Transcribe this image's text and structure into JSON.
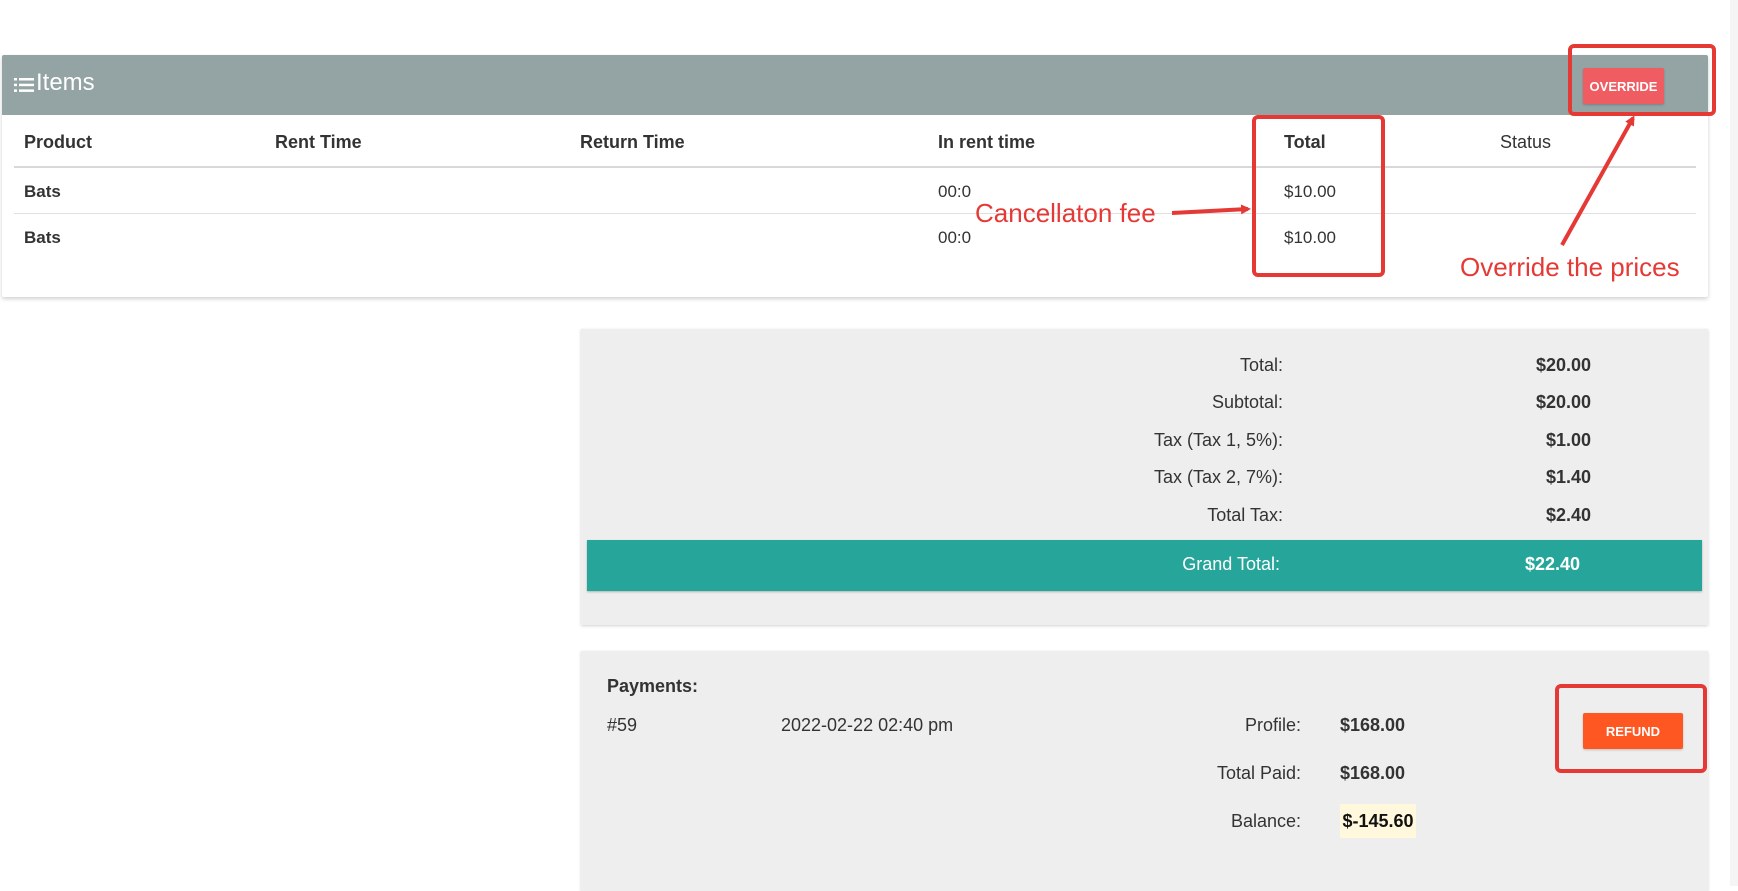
{
  "items": {
    "title": "Items",
    "override_label": "OVERRIDE",
    "columns": [
      "Product",
      "Rent Time",
      "Return Time",
      "In rent time",
      "Total",
      "Status"
    ],
    "rows": [
      {
        "product": "Bats",
        "rent_time": "",
        "return_time": "",
        "in_rent_time": "00:0",
        "total": "$10.00",
        "status": ""
      },
      {
        "product": "Bats",
        "rent_time": "",
        "return_time": "",
        "in_rent_time": "00:0",
        "total": "$10.00",
        "status": ""
      }
    ]
  },
  "totals": {
    "total_label": "Total:",
    "total_value": "$20.00",
    "subtotal_label": "Subtotal:",
    "subtotal_value": "$20.00",
    "tax1_label": "Tax (Tax 1, 5%):",
    "tax1_value": "$1.00",
    "tax2_label": "Tax (Tax 2, 7%):",
    "tax2_value": "$1.40",
    "total_tax_label": "Total Tax:",
    "total_tax_value": "$2.40",
    "grand_total_label": "Grand Total:",
    "grand_total_value": "$22.40"
  },
  "payments": {
    "heading": "Payments:",
    "id": "#59",
    "date": "2022-02-22 02:40 pm",
    "profile_label": "Profile:",
    "profile_value": "$168.00",
    "total_paid_label": "Total Paid:",
    "total_paid_value": "$168.00",
    "balance_label": "Balance:",
    "balance_value": "$-145.60",
    "refund_label": "REFUND"
  },
  "annotations": {
    "cancellation_text": "Cancellaton fee",
    "override_text": "Override the prices"
  },
  "colors": {
    "header_bg": "#94a3a3",
    "override_btn": "#ef5d63",
    "grand_total_bar": "#26a69a",
    "refund_btn": "#ff5722",
    "annotation": "#e53935"
  }
}
